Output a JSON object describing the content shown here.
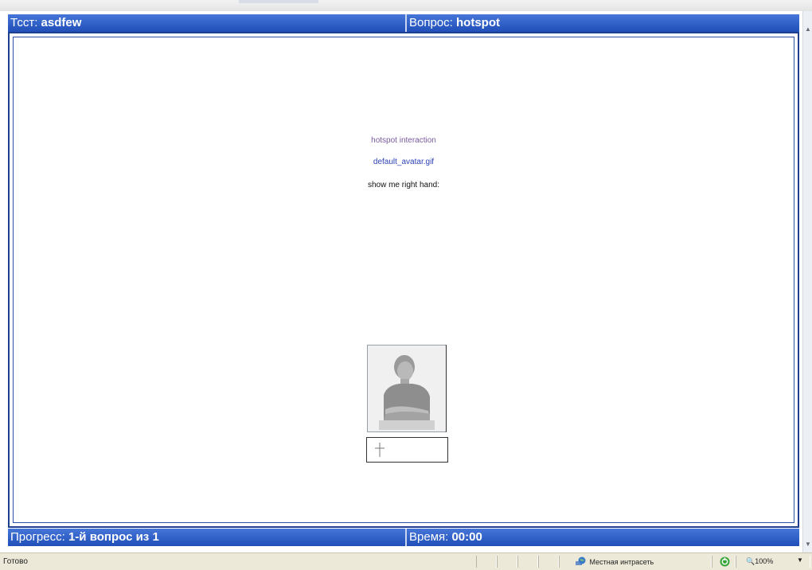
{
  "header": {
    "test_label": "Тсст:",
    "test_name": "asdfew",
    "question_label": "Вопрос:",
    "question_name": "hotspot"
  },
  "question": {
    "interaction_type": "hotspot interaction",
    "image_name": "default_avatar.gif",
    "prompt": "show me right hand:"
  },
  "footer": {
    "progress_label": "Прогресс:",
    "progress_value": "1-й вопрос из",
    "progress_total": "1",
    "time_label": "Время:",
    "time_value": "00:00"
  },
  "statusbar": {
    "status_text": "Готово",
    "zone_text": "Местная интрасеть",
    "zoom_text": "100%"
  },
  "colors": {
    "header_bar": "#2a59c4",
    "frame_border": "#1e3f8f",
    "status_bg": "#ece9d8"
  }
}
